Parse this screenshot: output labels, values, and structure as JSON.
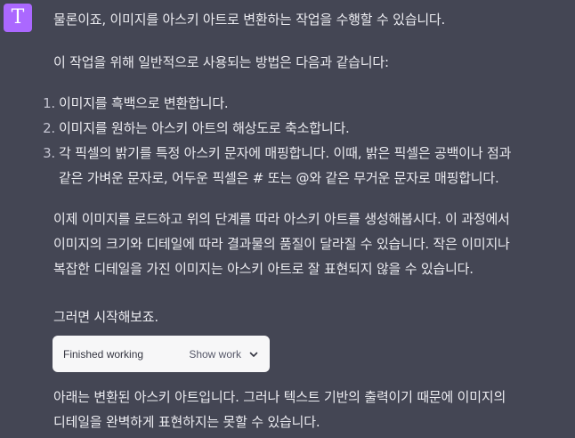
{
  "avatar": {
    "letter": "T",
    "color": "#ab68ff"
  },
  "message": {
    "p1": "물론이죠, 이미지를 아스키 아트로 변환하는 작업을 수행할 수 있습니다.",
    "p2": "이 작업을 위해 일반적으로 사용되는 방법은 다음과 같습니다:",
    "steps": [
      {
        "num": "1.",
        "lines": [
          "이미지를 흑백으로 변환합니다."
        ]
      },
      {
        "num": "2.",
        "lines": [
          "이미지를 원하는 아스키 아트의 해상도로 축소합니다."
        ]
      },
      {
        "num": "3.",
        "lines": [
          "각 픽셀의 밝기를 특정 아스키 문자에 매핑합니다. 이때, 밝은 픽셀은 공백이나 점과",
          "같은 가벼운 문자로, 어두운 픽셀은 # 또는 @와 같은 무거운 문자로 매핑합니다."
        ]
      }
    ],
    "p3": [
      "이제 이미지를 로드하고 위의 단계를 따라 아스키 아트를 생성해봅시다. 이 과정에서",
      "이미지의 크기와 디테일에 따라 결과물의 품질이 달라질 수 있습니다. 작은 이미지나",
      "복잡한 디테일을 가진 이미지는 아스키 아트로 잘 표현되지 않을 수 있습니다."
    ],
    "p4": "그러면 시작해보죠.",
    "p5": [
      "아래는 변환된 아스키 아트입니다. 그러나 텍스트 기반의 출력이기 때문에 이미지의",
      "디테일을 완벽하게 표현하지는 못할 수 있습니다."
    ]
  },
  "work": {
    "status": "Finished working",
    "toggle": "Show work",
    "icon": "chevron-down-icon"
  },
  "colors": {
    "background": "#444654",
    "text": "#ececf1",
    "pill": "#f7f7f8"
  }
}
